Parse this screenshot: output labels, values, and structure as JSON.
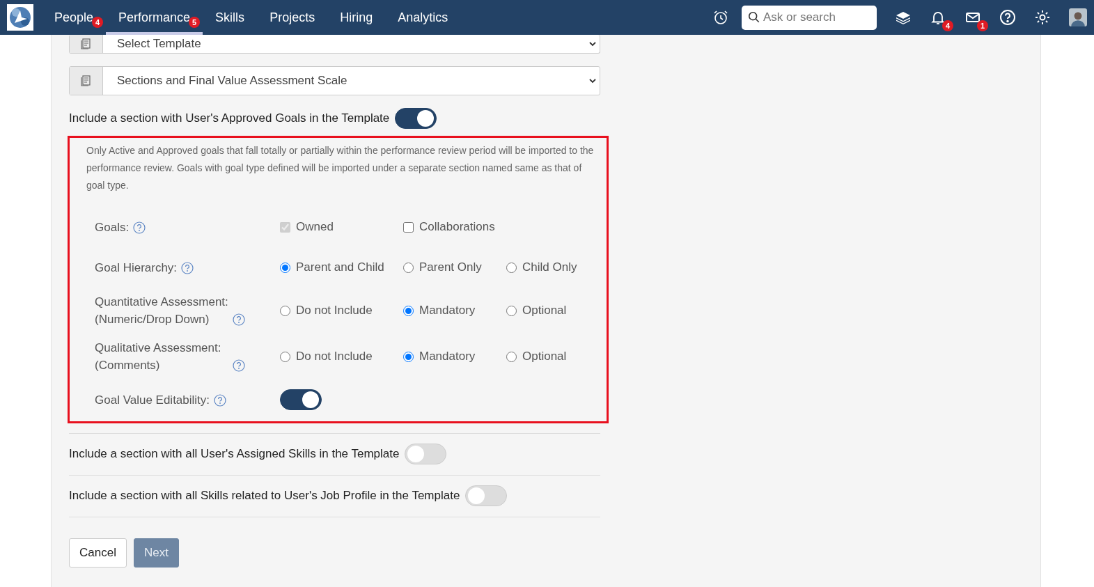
{
  "nav": {
    "items": [
      {
        "label": "People",
        "badge": "4",
        "selected": false
      },
      {
        "label": "Performance",
        "badge": "5",
        "selected": true
      },
      {
        "label": "Skills",
        "selected": false
      },
      {
        "label": "Projects",
        "selected": false
      },
      {
        "label": "Hiring",
        "selected": false
      },
      {
        "label": "Analytics",
        "selected": false
      }
    ],
    "search": {
      "placeholder": "Ask or search"
    },
    "notifications_badge": "4",
    "messages_badge": "1"
  },
  "selects": [
    {
      "value": "Select Template"
    },
    {
      "value": "Sections and Final Value Assessment Scale"
    }
  ],
  "goals_section": {
    "label": "Include a section with User's Approved Goals in the Template",
    "on": true,
    "description": "Only Active and Approved goals that fall totally or partially within the performance review period will be imported to the performance review. Goals with goal type defined will be imported under a separate section named same as that of goal type.",
    "rows": [
      {
        "kind": "checkbox",
        "label": "Goals:",
        "options": [
          {
            "label": "Owned",
            "checked": true,
            "disabled": true
          },
          {
            "label": "Collaborations",
            "checked": false,
            "disabled": false
          }
        ]
      },
      {
        "kind": "radio",
        "label": "Goal Hierarchy:",
        "options": [
          {
            "label": "Parent and Child",
            "selected": true
          },
          {
            "label": "Parent Only",
            "selected": false
          },
          {
            "label": "Child Only",
            "selected": false
          }
        ]
      },
      {
        "kind": "radio",
        "label": "Quantitative Assessment: (Numeric/Drop Down)",
        "options": [
          {
            "label": "Do not Include",
            "selected": false
          },
          {
            "label": "Mandatory",
            "selected": true
          },
          {
            "label": "Optional",
            "selected": false
          }
        ]
      },
      {
        "kind": "radio",
        "label": "Qualitative Assessment: (Comments)",
        "options": [
          {
            "label": "Do not Include",
            "selected": false
          },
          {
            "label": "Mandatory",
            "selected": true
          },
          {
            "label": "Optional",
            "selected": false
          }
        ]
      },
      {
        "kind": "toggle",
        "label": "Goal Value Editability:",
        "on": true
      }
    ]
  },
  "other_sections": [
    {
      "label": "Include a section with all User's Assigned Skills in the Template",
      "on": false
    },
    {
      "label": "Include a section with all Skills related to User's Job Profile in the Template",
      "on": false
    }
  ],
  "buttons": [
    {
      "label": "Cancel",
      "kind": "secondary",
      "disabled": false
    },
    {
      "label": "Next",
      "kind": "primary",
      "disabled": true
    }
  ]
}
